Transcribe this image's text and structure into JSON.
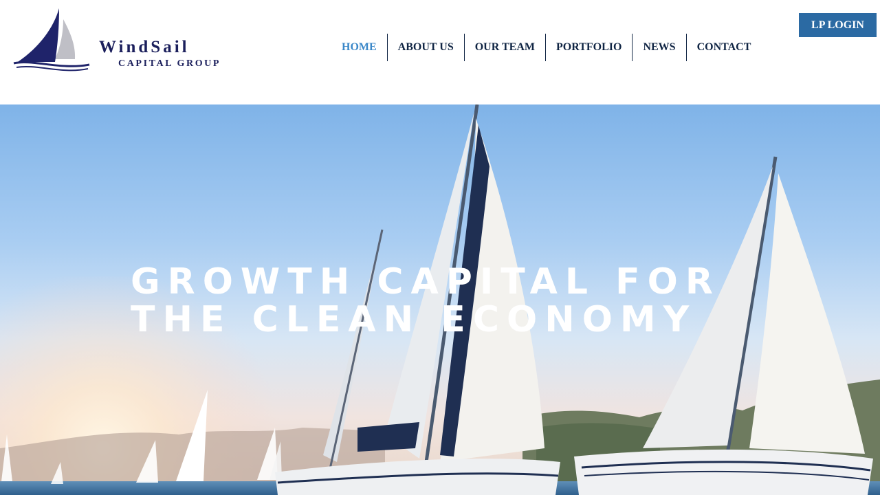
{
  "logo": {
    "wordmark": "WindSail",
    "tagline": "CAPITAL GROUP",
    "icon": "sailboat-logo-icon",
    "colors": {
      "navy": "#1b1f5c",
      "grey": "#bfbfc6"
    }
  },
  "nav": {
    "items": [
      {
        "label": "HOME",
        "active": true
      },
      {
        "label": "ABOUT US",
        "active": false
      },
      {
        "label": "OUR TEAM",
        "active": false
      },
      {
        "label": "PORTFOLIO",
        "active": false
      },
      {
        "label": "NEWS",
        "active": false
      },
      {
        "label": "CONTACT",
        "active": false
      }
    ],
    "active_color": "#3a87c8",
    "text_color": "#0f2443"
  },
  "login": {
    "label": "LP LOGIN",
    "color": "#2b6aa3"
  },
  "hero": {
    "title_line1": "GROWTH CAPITAL FOR",
    "title_line2": "THE CLEAN ECONOMY",
    "image": "sailboats-regatta-photo"
  }
}
